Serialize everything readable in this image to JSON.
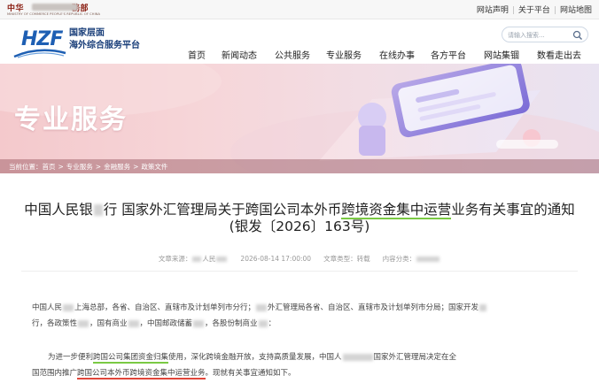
{
  "topbar": {
    "ministry_cn_a": "中华",
    "ministry_cn_b": "務部",
    "ministry_en": "MINISTRY OF COMMERCE PEOPLE'S REPUBLIC OF CHINA",
    "links": [
      "网站声明",
      "关于平台",
      "网站地图"
    ]
  },
  "header": {
    "logo_text": "HZF",
    "platform_line1": "国家层面",
    "platform_line2": "海外综合服务平台",
    "search_placeholder": "请输入搜索..."
  },
  "nav": [
    "首页",
    "新闻动态",
    "公共服务",
    "专业服务",
    "在线办事",
    "各方平台",
    "网站集锢",
    "数看走出去"
  ],
  "banner": {
    "title": "专业服务",
    "breadcrumb_label": "当前位置：",
    "breadcrumb": [
      "首页",
      "专业服务",
      "金融服务",
      "政策文件"
    ]
  },
  "article": {
    "title_a": "中国人民银",
    "title_b": "行 国家外汇管理局关于跨国公司本外币",
    "title_c": "跨境资金集中运营",
    "title_d": "业务有关事宜的通知",
    "title_line2": "(银发〔2026〕163号)",
    "meta": {
      "source_label": "文章来源：",
      "source": "人民",
      "date": "2026-08-14 17:00:00",
      "type_label": "文章类型：",
      "type": "转载",
      "category_label": "内容分类："
    },
    "para1_line1": [
      "中国人民",
      "上海总部，各省、自治区、直辖市及计划单列市分行；",
      "外汇管理局各省、自治区、直辖市及计划单列市分局；国家开发"
    ],
    "para1_line2": [
      "行，各政策性",
      "，国有商业",
      "，中国邮政储蓄",
      "，各股份制商业",
      "："
    ],
    "para2_line1": [
      "为进一步便利",
      "跨国公司集团资金归集",
      "使用，深化跨境金融开放，支持高质量发展，中国人",
      "国家外汇管理局决定在全"
    ],
    "para2_line2": [
      "国范围内推广",
      "跨国公司本外币跨境资金集中运营业务",
      "。现就有关事宜通知如下。"
    ]
  },
  "colors": {
    "brand_blue": "#1e5fb3",
    "highlight_green": "#7ac943",
    "highlight_red": "#e0463a"
  }
}
